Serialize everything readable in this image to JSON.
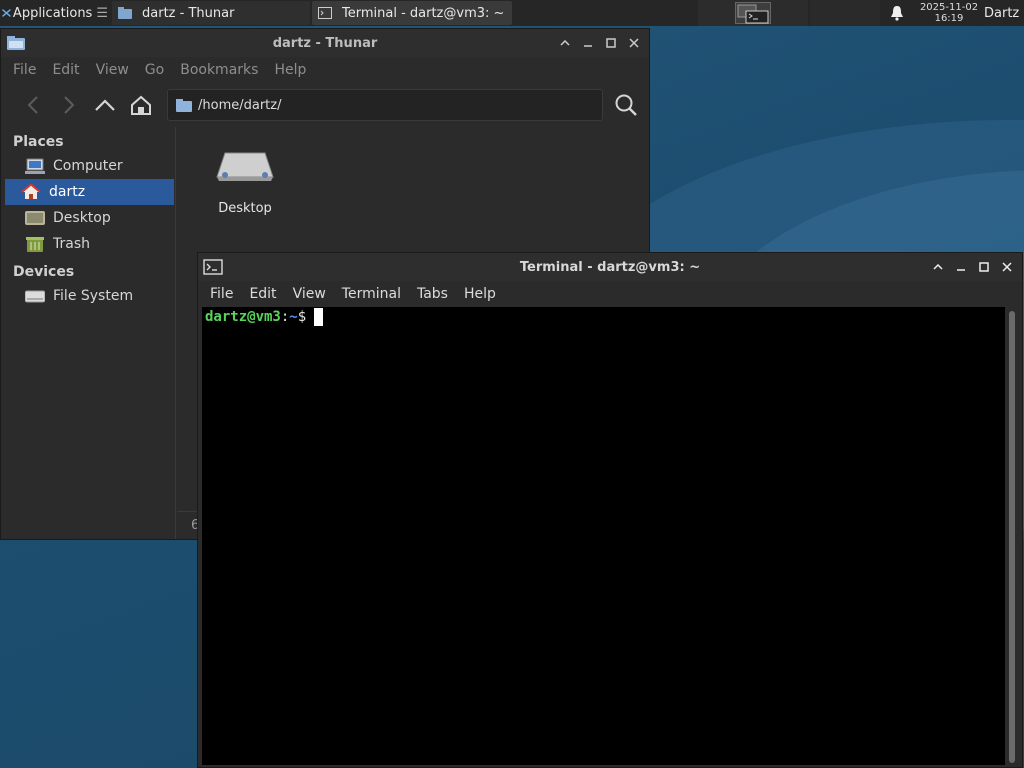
{
  "panel": {
    "applications_label": "Applications",
    "tasks": [
      {
        "label": "dartz - Thunar"
      },
      {
        "label": "Terminal - dartz@vm3: ~"
      }
    ],
    "clock_date": "2025-11-02",
    "clock_time": "16:19",
    "user": "Dartz"
  },
  "thunar": {
    "title": "dartz - Thunar",
    "menu": [
      "File",
      "Edit",
      "View",
      "Go",
      "Bookmarks",
      "Help"
    ],
    "location": "/home/dartz/",
    "sidebar": {
      "places_label": "Places",
      "places": [
        {
          "label": "Computer",
          "icon": "computer-icon"
        },
        {
          "label": "dartz",
          "icon": "home-icon",
          "selected": true
        },
        {
          "label": "Desktop",
          "icon": "desktop-folder-icon"
        },
        {
          "label": "Trash",
          "icon": "trash-icon"
        }
      ],
      "devices_label": "Devices",
      "devices": [
        {
          "label": "File System",
          "icon": "drive-icon"
        }
      ]
    },
    "files": [
      {
        "label": "Desktop",
        "icon": "desktop-icon"
      }
    ],
    "status": "6"
  },
  "terminal": {
    "title": "Terminal - dartz@vm3: ~",
    "menu": [
      "File",
      "Edit",
      "View",
      "Terminal",
      "Tabs",
      "Help"
    ],
    "prompt_user": "dartz@vm3",
    "prompt_colon": ":",
    "prompt_dir": "~",
    "prompt_dollar": "$"
  },
  "colors": {
    "selection": "#2a5a9b",
    "prompt_user": "#5ad35a",
    "prompt_dir": "#5b8ff0",
    "desktop": "#1e4f70"
  }
}
